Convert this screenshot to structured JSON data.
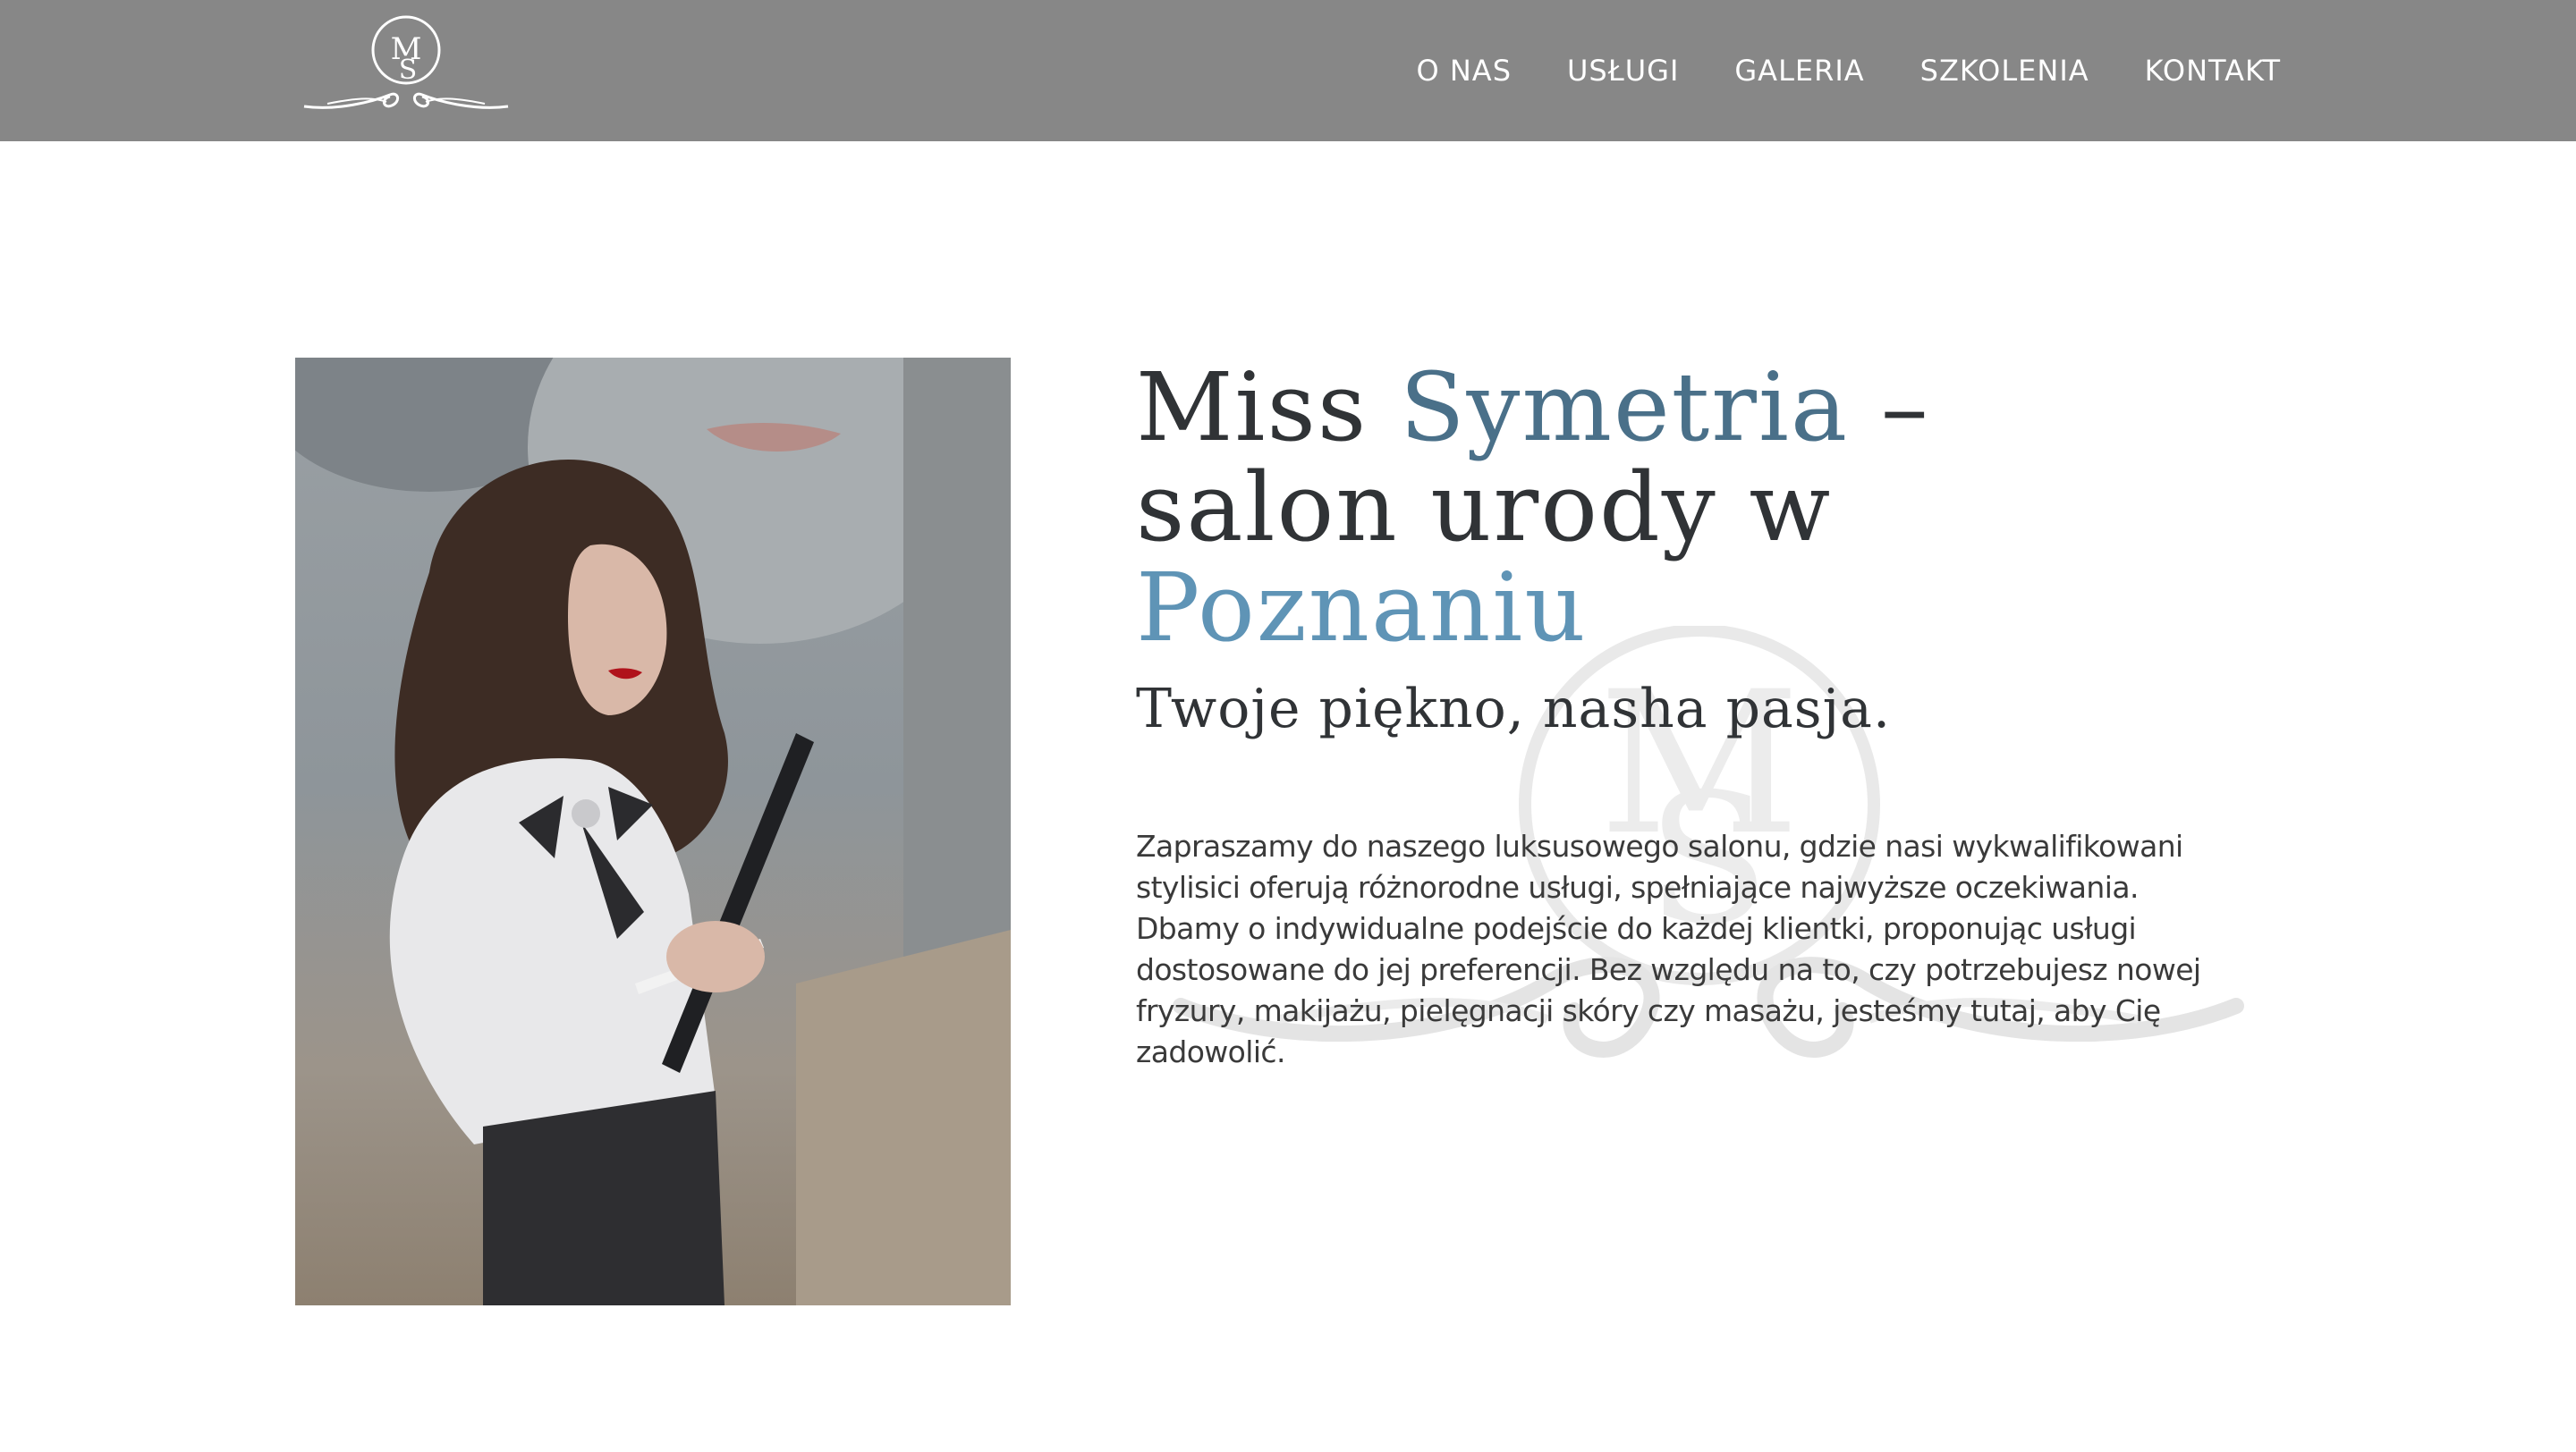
{
  "header": {
    "logo_monogram": "MS",
    "nav": [
      {
        "label": "O NAS"
      },
      {
        "label": "USŁUGI"
      },
      {
        "label": "GALERIA"
      },
      {
        "label": "SZKOLENIA"
      },
      {
        "label": "KONTAKT"
      }
    ]
  },
  "hero": {
    "title_line1_part1": "Miss ",
    "title_line1_part2": "Symetria",
    "title_line1_part3": " –",
    "title_line2_part1": "salon urody w ",
    "title_line2_part2": "Poznaniu",
    "subtitle": "Twoje piękno, nasha pasja.",
    "description": "Zapraszamy do naszego luksusowego salonu, gdzie nasi wykwalifikowani stylisici oferują różnorodne usługi, spełniające najwyższe oczekiwania. Dbamy o indywidualne podejście do każdej klientki, proponując usługi dostosowane do jej preferencji. Bez względu na to, czy potrzebujesz nowej fryzury, makijażu, pielęgnacji skóry czy masażu, jesteśmy tutaj, aby Cię zadowolić."
  },
  "colors": {
    "header_bg": "#878787",
    "title_dark": "#303336",
    "accent_blue_dark": "#4a7089",
    "accent_blue_light": "#5f94b6",
    "watermark": "#e6e6e6"
  }
}
